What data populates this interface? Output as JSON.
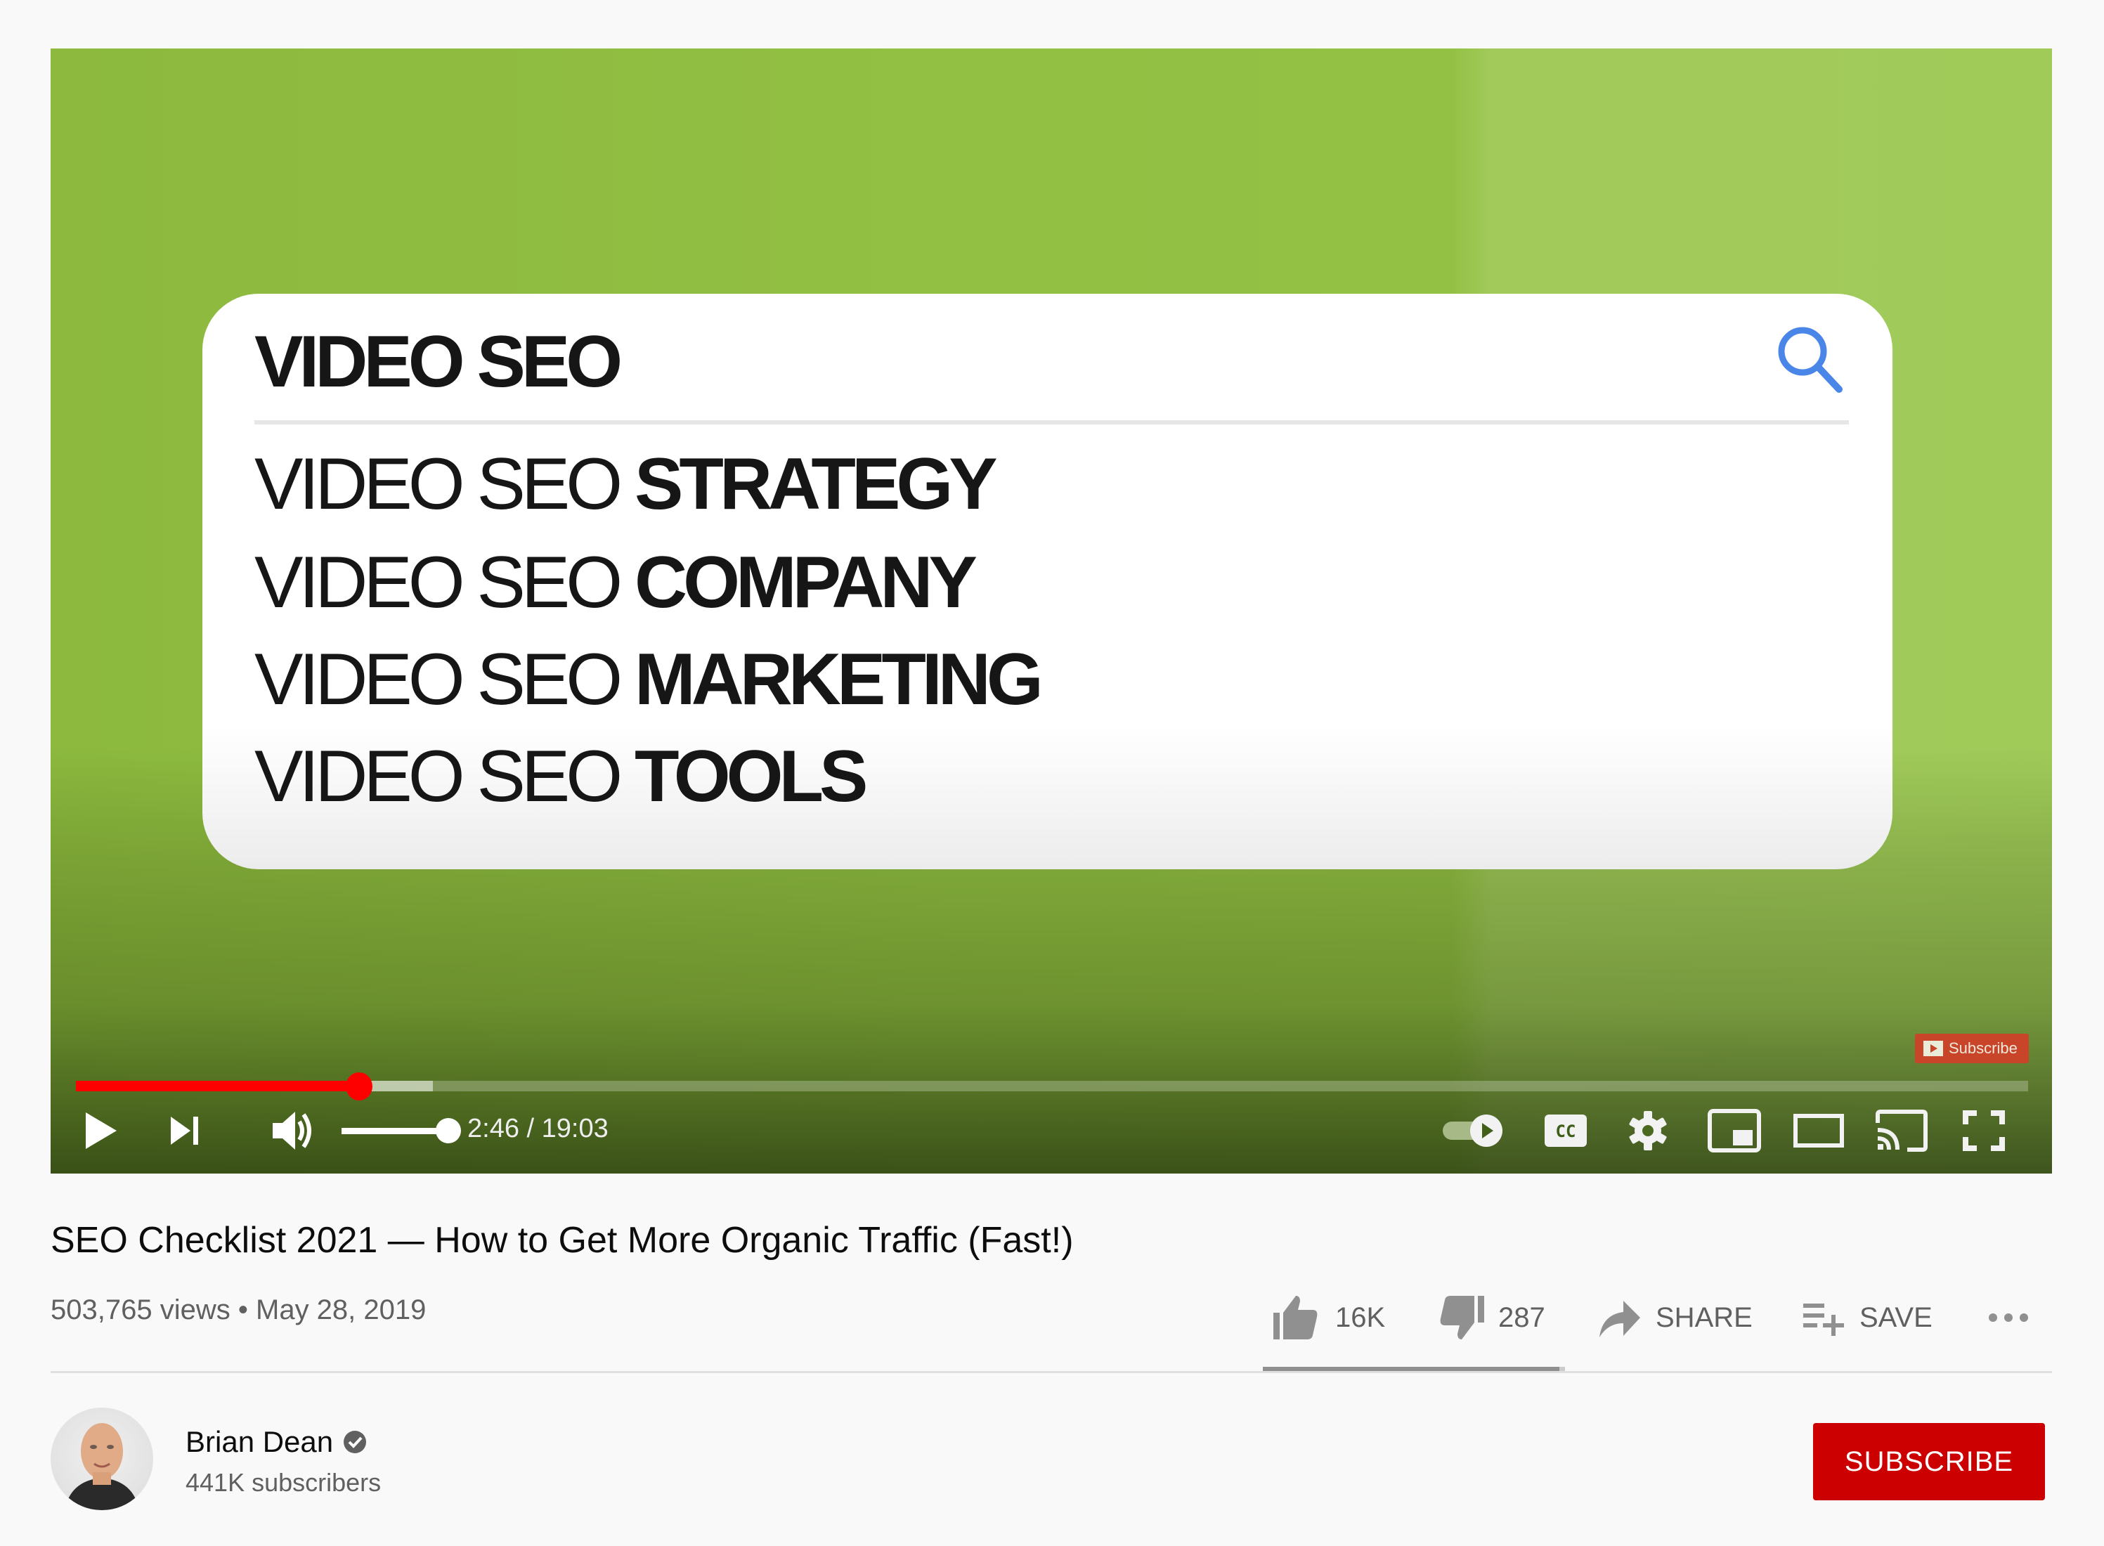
{
  "video": {
    "frame": {
      "search_query": "VIDEO SEO",
      "suggestions": [
        {
          "prefix": "VIDEO SEO ",
          "suffix": "STRATEGY"
        },
        {
          "prefix": "VIDEO SEO ",
          "suffix": "COMPANY"
        },
        {
          "prefix": "VIDEO SEO ",
          "suffix": "MARKETING"
        },
        {
          "prefix": "VIDEO SEO ",
          "suffix": "TOOLS"
        }
      ],
      "watermark_label": "Subscribe",
      "search_icon_color": "#4a86e8",
      "background_color": "#92c043"
    },
    "player": {
      "current_time": "2:46",
      "duration": "19:03",
      "time_display": "2:46 / 19:03",
      "played_fraction": 0.145,
      "buffered_fraction": 0.183,
      "volume_fraction": 1.0,
      "autoplay_on": true,
      "progress_color": "#ff0000",
      "controls": {
        "play": "play-icon",
        "next": "next-icon",
        "volume": "volume-icon",
        "autoplay": "autoplay-toggle-icon",
        "captions": "cc-icon",
        "settings": "gear-icon",
        "miniplayer": "miniplayer-icon",
        "theater": "theater-mode-icon",
        "cast": "cast-icon",
        "fullscreen": "fullscreen-icon"
      }
    }
  },
  "info": {
    "title": "SEO Checklist 2021 — How to Get More Organic Traffic (Fast!)",
    "views": "503,765 views",
    "separator": "•",
    "date": "May 28, 2019",
    "meta_line": "503,765 views • May 28, 2019"
  },
  "actions": {
    "likes": "16K",
    "dislikes": "287",
    "like_ratio": 0.982,
    "share_label": "SHARE",
    "save_label": "SAVE",
    "more_label": "•••"
  },
  "channel": {
    "name": "Brian Dean",
    "verified": true,
    "subscribers": "441K subscribers",
    "subscribe_label": "SUBSCRIBE",
    "subscribe_color": "#cc0000"
  }
}
